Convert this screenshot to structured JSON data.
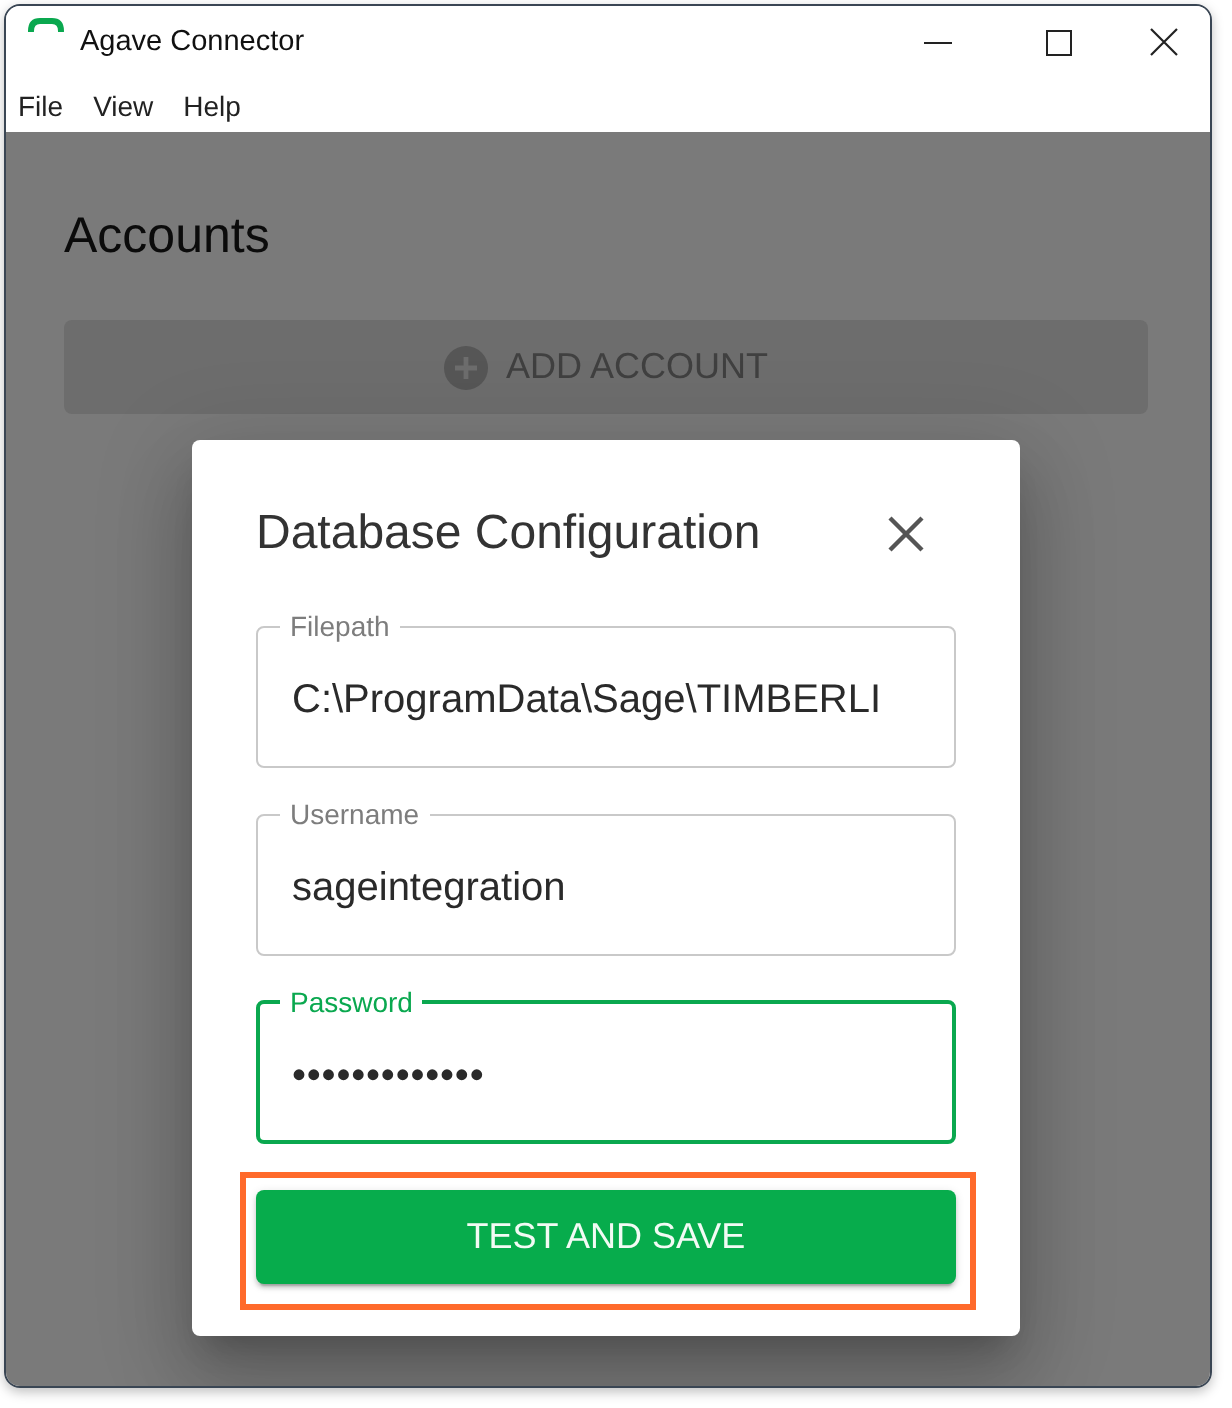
{
  "window": {
    "title": "Agave Connector"
  },
  "menu": [
    "File",
    "View",
    "Help"
  ],
  "page": {
    "heading": "Accounts",
    "add_button": {
      "label": "ADD ACCOUNT",
      "disabled": true
    }
  },
  "dialog": {
    "title": "Database Configuration",
    "fields": [
      {
        "kind": "text",
        "label": "Filepath",
        "value": "C:\\ProgramData\\Sage\\TIMBERLI",
        "focused": false
      },
      {
        "kind": "text",
        "label": "Username",
        "value": "sageintegration",
        "focused": false
      },
      {
        "kind": "password",
        "label": "Password",
        "value": "•••••••••••••",
        "focused": true
      }
    ],
    "submit": {
      "label": "TEST AND SAVE",
      "highlighted": true
    }
  }
}
